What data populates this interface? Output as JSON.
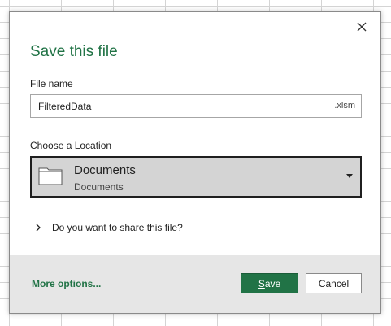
{
  "dialog": {
    "title": "Save this file",
    "close_icon": "close-icon"
  },
  "filename": {
    "label": "File name",
    "value": "FilteredData",
    "extension": ".xlsm"
  },
  "location": {
    "label": "Choose a Location",
    "selected_name": "Documents",
    "selected_path": "Documents",
    "icon": "folder-icon"
  },
  "share": {
    "label": "Do you want to share this file?",
    "icon": "chevron-right-icon"
  },
  "footer": {
    "more_options": "More options...",
    "save_accel": "S",
    "save_rest": "ave",
    "cancel": "Cancel"
  },
  "colors": {
    "accent": "#217346",
    "footer_bg": "#e6e6e6",
    "select_bg": "#d4d4d4"
  }
}
